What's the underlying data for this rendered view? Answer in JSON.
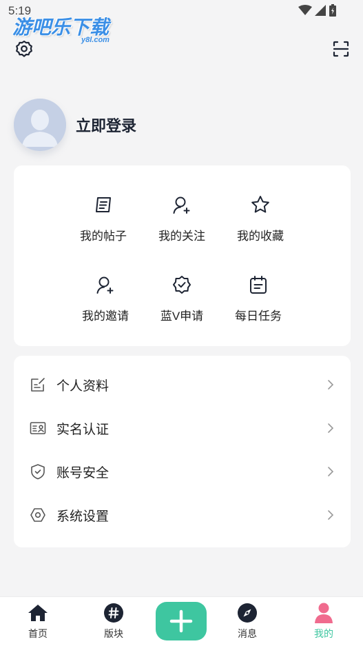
{
  "status_bar": {
    "time": "5:19"
  },
  "watermark": {
    "main": "游吧乐下载",
    "sub": "y8l.com"
  },
  "profile": {
    "login_label": "立即登录"
  },
  "grid": [
    {
      "label": "我的帖子",
      "icon": "posts-icon"
    },
    {
      "label": "我的关注",
      "icon": "follow-icon"
    },
    {
      "label": "我的收藏",
      "icon": "star-icon"
    },
    {
      "label": "我的邀请",
      "icon": "invite-icon"
    },
    {
      "label": "蓝V申请",
      "icon": "verified-badge-icon"
    },
    {
      "label": "每日任务",
      "icon": "calendar-icon"
    }
  ],
  "menu": [
    {
      "label": "个人资料",
      "icon": "edit-profile-icon"
    },
    {
      "label": "实名认证",
      "icon": "id-card-icon"
    },
    {
      "label": "账号安全",
      "icon": "shield-icon"
    },
    {
      "label": "系统设置",
      "icon": "hexagon-settings-icon"
    }
  ],
  "tabs": [
    {
      "label": "首页",
      "icon": "home-icon",
      "active": false
    },
    {
      "label": "版块",
      "icon": "hash-icon",
      "active": false
    },
    {
      "label": "消息",
      "icon": "compass-icon",
      "active": false
    },
    {
      "label": "我的",
      "icon": "user-icon",
      "active": true
    }
  ],
  "colors": {
    "accent": "#3ec6a0",
    "active_tab_icon": "#f06b8e",
    "text_dark": "#1d2433"
  }
}
